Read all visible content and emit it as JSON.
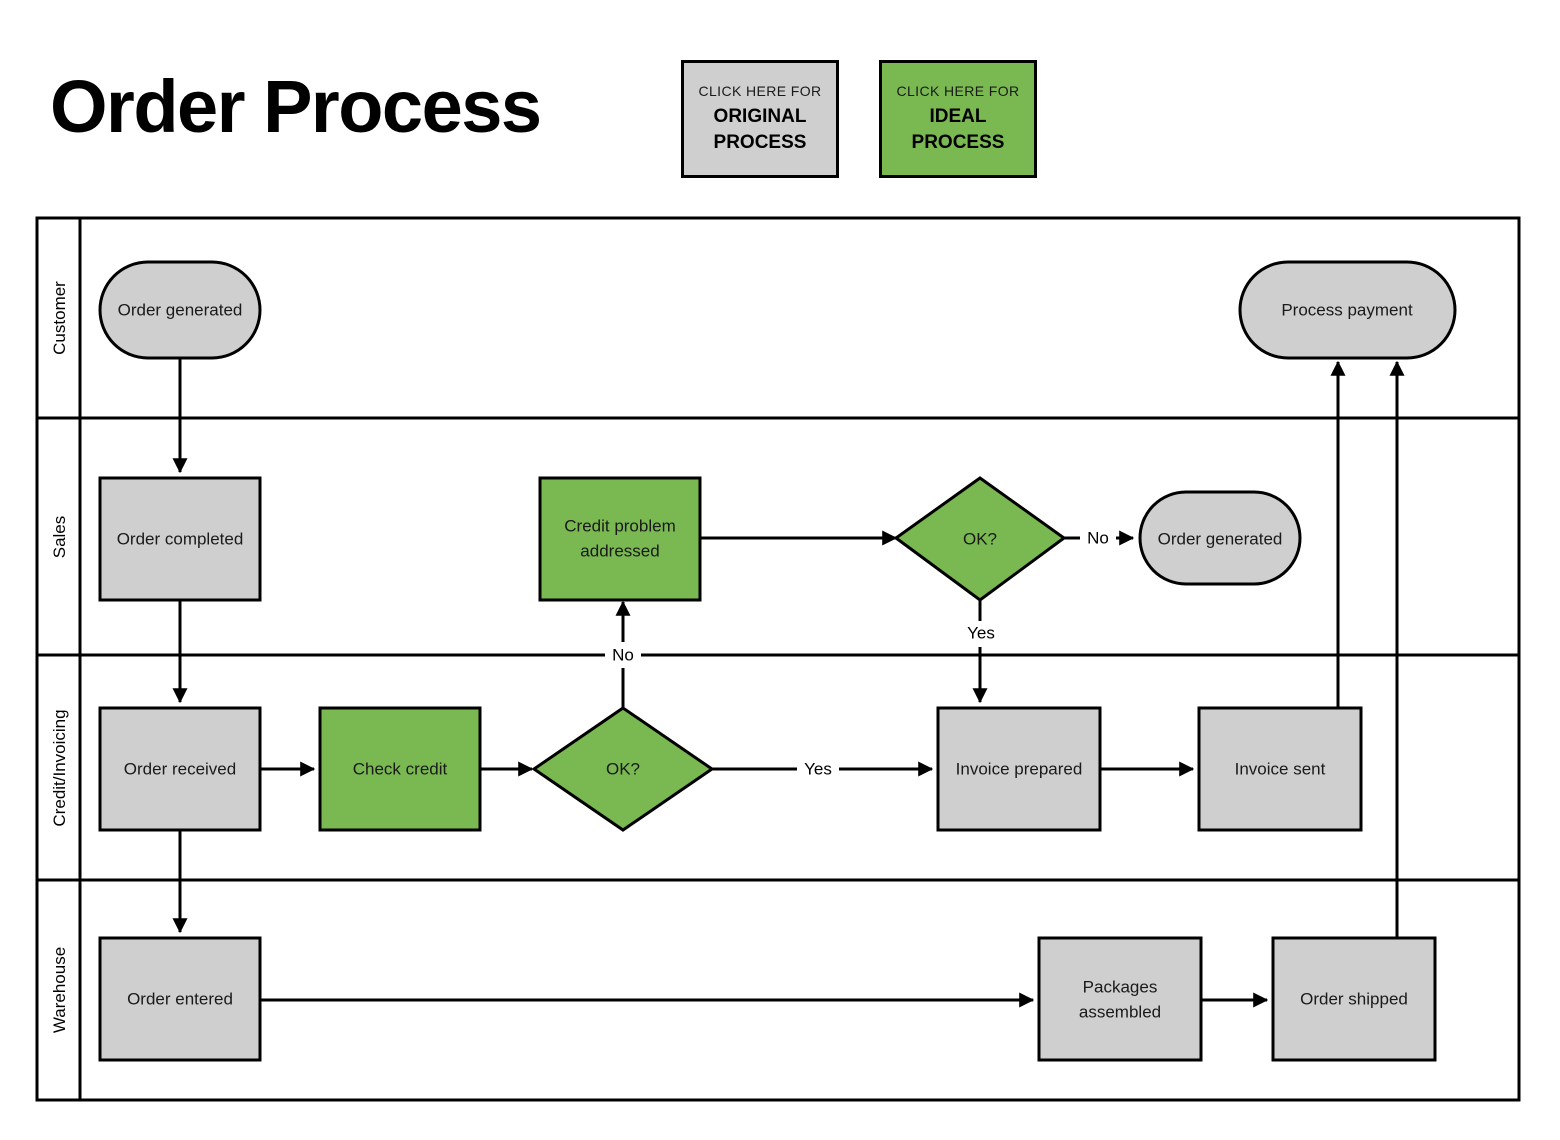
{
  "header": {
    "title": "Order Process",
    "legend_buttons": [
      {
        "kicker": "CLICK HERE FOR",
        "line1": "ORIGINAL",
        "line2": "PROCESS",
        "color": "#cfcfcf"
      },
      {
        "kicker": "CLICK HERE FOR",
        "line1": "IDEAL",
        "line2": "PROCESS",
        "color": "#7ab851"
      }
    ]
  },
  "colors": {
    "original_gray": "#cfcfcf",
    "ideal_green": "#7ab851",
    "stroke": "#000000",
    "background": "#ffffff"
  },
  "swimlanes": [
    {
      "id": "customer",
      "label": "Customer"
    },
    {
      "id": "sales",
      "label": "Sales"
    },
    {
      "id": "credit",
      "label": "Credit/Invoicing"
    },
    {
      "id": "warehouse",
      "label": "Warehouse"
    }
  ],
  "nodes": [
    {
      "id": "order-generated-customer",
      "label": "Order generated",
      "lane": "customer",
      "shape": "rounded",
      "fill": "#cfcfcf"
    },
    {
      "id": "process-payment",
      "label": "Process payment",
      "lane": "customer",
      "shape": "rounded",
      "fill": "#cfcfcf"
    },
    {
      "id": "order-completed",
      "label": "Order completed",
      "lane": "sales",
      "shape": "rect",
      "fill": "#cfcfcf"
    },
    {
      "id": "credit-problem-addressed",
      "label_line1": "Credit problem",
      "label_line2": "addressed",
      "lane": "sales",
      "shape": "rect",
      "fill": "#7ab851"
    },
    {
      "id": "ok-sales",
      "label": "OK?",
      "lane": "sales",
      "shape": "diamond",
      "fill": "#7ab851"
    },
    {
      "id": "order-generated-sales",
      "label": "Order generated",
      "lane": "sales",
      "shape": "rounded",
      "fill": "#cfcfcf"
    },
    {
      "id": "order-received",
      "label": "Order received",
      "lane": "credit",
      "shape": "rect",
      "fill": "#cfcfcf"
    },
    {
      "id": "check-credit",
      "label": "Check credit",
      "lane": "credit",
      "shape": "rect",
      "fill": "#7ab851"
    },
    {
      "id": "ok-credit",
      "label": "OK?",
      "lane": "credit",
      "shape": "diamond",
      "fill": "#7ab851"
    },
    {
      "id": "invoice-prepared",
      "label": "Invoice prepared",
      "lane": "credit",
      "shape": "rect",
      "fill": "#cfcfcf"
    },
    {
      "id": "invoice-sent",
      "label": "Invoice sent",
      "lane": "credit",
      "shape": "rect",
      "fill": "#cfcfcf"
    },
    {
      "id": "order-entered",
      "label": "Order entered",
      "lane": "warehouse",
      "shape": "rect",
      "fill": "#cfcfcf"
    },
    {
      "id": "packages-assembled",
      "label_line1": "Packages",
      "label_line2": "assembled",
      "lane": "warehouse",
      "shape": "rect",
      "fill": "#cfcfcf"
    },
    {
      "id": "order-shipped",
      "label": "Order shipped",
      "lane": "warehouse",
      "shape": "rect",
      "fill": "#cfcfcf"
    }
  ],
  "edge_labels": {
    "credit_ok_no": "No",
    "credit_ok_yes": "Yes",
    "sales_ok_no": "No",
    "sales_ok_yes": "Yes"
  },
  "edges": [
    {
      "from": "order-generated-customer",
      "to": "order-completed",
      "label": ""
    },
    {
      "from": "order-completed",
      "to": "order-received",
      "label": ""
    },
    {
      "from": "order-received",
      "to": "check-credit",
      "label": ""
    },
    {
      "from": "order-received",
      "to": "order-entered",
      "label": ""
    },
    {
      "from": "check-credit",
      "to": "ok-credit",
      "label": ""
    },
    {
      "from": "ok-credit",
      "to": "credit-problem-addressed",
      "label": "No"
    },
    {
      "from": "ok-credit",
      "to": "invoice-prepared",
      "label": "Yes"
    },
    {
      "from": "credit-problem-addressed",
      "to": "ok-sales",
      "label": ""
    },
    {
      "from": "ok-sales",
      "to": "order-generated-sales",
      "label": "No"
    },
    {
      "from": "ok-sales",
      "to": "invoice-prepared",
      "label": "Yes"
    },
    {
      "from": "invoice-prepared",
      "to": "invoice-sent",
      "label": ""
    },
    {
      "from": "invoice-sent",
      "to": "process-payment",
      "label": ""
    },
    {
      "from": "order-entered",
      "to": "packages-assembled",
      "label": ""
    },
    {
      "from": "packages-assembled",
      "to": "order-shipped",
      "label": ""
    },
    {
      "from": "order-shipped",
      "to": "process-payment",
      "label": ""
    }
  ]
}
